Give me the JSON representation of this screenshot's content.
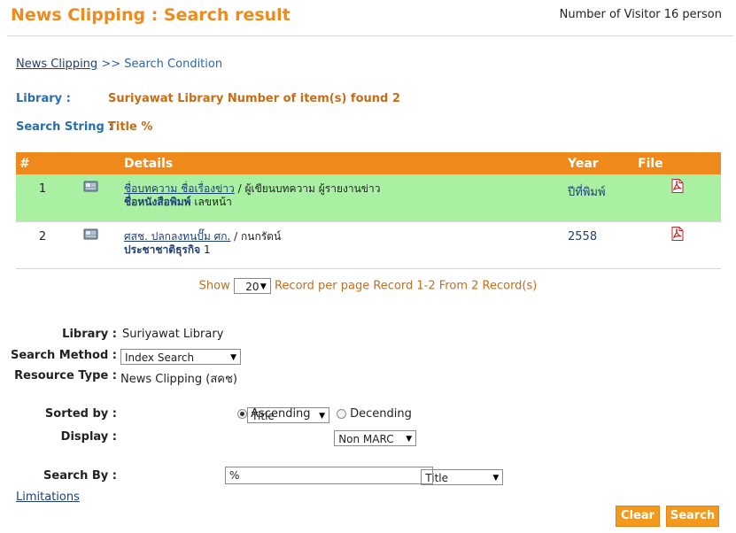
{
  "header": {
    "title": "News Clipping : Search result",
    "visitor": "Number of Visitor 16 person"
  },
  "breadcrumb": {
    "link": "News Clipping",
    "separator": ">>",
    "current": "Search Condition"
  },
  "summary": {
    "library_label": "Library :",
    "library_value": "Suriyawat Library Number of item(s) found 2",
    "search_string_label": "Search String :",
    "search_string_value": "Title %"
  },
  "table": {
    "headers": [
      "#",
      "",
      "Details",
      "Year",
      "File"
    ],
    "rows": [
      {
        "num": "1",
        "title_link": "ชื่อบทความ ชื่อเรื่องข่าว",
        "author": " / ผู้เขียนบทความ ผู้รายงานข่าว",
        "source": "ชื่อหนังสือพิมพ์",
        "page": " เลขหน้า",
        "year": "ปีที่พิมพ์"
      },
      {
        "num": "2",
        "title_link": "ศสช. ปลกลงทนปั๊ม ศก.",
        "author": " / กนกรัตน์",
        "source": "ประชาชาติธุรกิจ",
        "page": " 1",
        "year": "2558"
      }
    ]
  },
  "pager": {
    "show_label": "Show",
    "per_page": "20",
    "text": "Record per page Record 1-2 From 2 Record(s)"
  },
  "form": {
    "library_label": "Library :",
    "library_value": "Suriyawat Library",
    "search_method_label": "Search Method :",
    "search_method_value": "Index Search",
    "resource_type_label": "Resource Type :",
    "resource_type_value": "News Clipping (สคช)",
    "sorted_by_label": "Sorted by :",
    "sorted_by_value": "Title",
    "ascending_label": "Ascending",
    "descending_label": "Decending",
    "sort_order_selected": "Ascending",
    "display_label": "Display :",
    "display_value": "Non MARC",
    "search_by_label": "Search By :",
    "search_by_value": "Title",
    "search_text": "%",
    "limitations_link": "Limitations",
    "clear_button": "Clear",
    "search_button": "Search"
  },
  "colors": {
    "accent": "#f0891c",
    "row_highlight": "#a9f0a3",
    "link": "#1f3f77"
  }
}
